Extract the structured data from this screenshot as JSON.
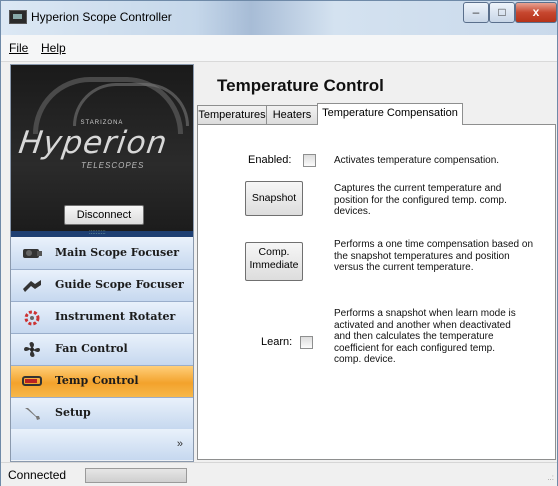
{
  "window": {
    "title": "Hyperion Scope Controller"
  },
  "controls": {
    "minimize": "–",
    "maximize": "□",
    "close": "x"
  },
  "menu": {
    "file_label": "File",
    "help_label": "Help"
  },
  "logo": {
    "brand": "STARIZONA",
    "name": "Hyperion",
    "sub": "TELESCOPES"
  },
  "left": {
    "disconnect_label": "Disconnect",
    "more": "»"
  },
  "nav": [
    {
      "label": "Main Scope Focuser",
      "icon": "focuser-icon",
      "active": false
    },
    {
      "label": "Guide Scope Focuser",
      "icon": "guide-focuser-icon",
      "active": false
    },
    {
      "label": "Instrument Rotater",
      "icon": "rotator-icon",
      "active": false
    },
    {
      "label": "Fan Control",
      "icon": "fan-icon",
      "active": false
    },
    {
      "label": "Temp Control",
      "icon": "thermometer-icon",
      "active": true
    },
    {
      "label": "Setup",
      "icon": "wrench-icon",
      "active": false
    }
  ],
  "main": {
    "heading": "Temperature Control",
    "tabs": [
      "Temperatures",
      "Heaters",
      "Temperature Compensation"
    ],
    "selected_tab": "Temperature Compensation",
    "enabled_label": "Enabled:",
    "enabled_checked": false,
    "enabled_desc": "Activates temperature compensation.",
    "snapshot_label": "Snapshot",
    "snapshot_desc": "Captures the current temperature and position for the configured temp. comp. devices.",
    "comp_label_1": "Comp.",
    "comp_label_2": "Immediate",
    "comp_desc": "Performs a one time compensation based on the snapshot temperatures and position versus the current temperature.",
    "learn_label": "Learn:",
    "learn_checked": false,
    "learn_desc": "Performs a snapshot when learn mode is activated and another when deactivated and then calculates the temperature coefficient for each configured temp. comp. device."
  },
  "status": {
    "text": "Connected",
    "grip": "..:"
  }
}
